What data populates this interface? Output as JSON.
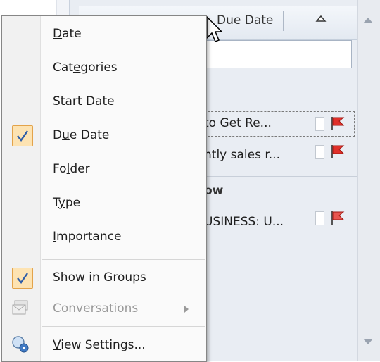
{
  "column_header": {
    "label": "Due Date"
  },
  "rows": [
    {
      "subject": "to Get Re..."
    },
    {
      "subject": "ntly sales r..."
    },
    {
      "subject": "USINESS: U..."
    }
  ],
  "group_label": "ow",
  "menu": {
    "items": [
      {
        "pre": "",
        "u": "D",
        "post": "ate",
        "checked": false
      },
      {
        "pre": "Cat",
        "u": "e",
        "post": "gories",
        "checked": false
      },
      {
        "pre": "Sta",
        "u": "r",
        "post": "t Date",
        "checked": false
      },
      {
        "pre": "D",
        "u": "u",
        "post": "e Date",
        "checked": true
      },
      {
        "pre": "Fo",
        "u": "l",
        "post": "der",
        "checked": false
      },
      {
        "pre": "T",
        "u": "y",
        "post": "pe",
        "checked": false
      },
      {
        "pre": "",
        "u": "I",
        "post": "mportance",
        "checked": false
      }
    ],
    "show_in_groups": {
      "pre": "Sho",
      "u": "w",
      "post": " in Groups",
      "checked": true
    },
    "conversations": {
      "pre": "",
      "u": "C",
      "post": "onversations",
      "disabled": true
    },
    "view_settings": {
      "pre": "",
      "u": "V",
      "post": "iew Settings..."
    }
  },
  "colors": {
    "flag": "#e0302a",
    "check_bg": "#fde3b2",
    "check_border": "#e3a34a",
    "check_mark": "#2e5da8"
  },
  "icons": [
    "sort-ascending-icon",
    "flag-icon",
    "checkmark-icon",
    "conversations-icon",
    "view-settings-icon",
    "submenu-arrow-icon",
    "mouse-cursor-icon",
    "scroll-up-icon",
    "scroll-down-icon"
  ]
}
